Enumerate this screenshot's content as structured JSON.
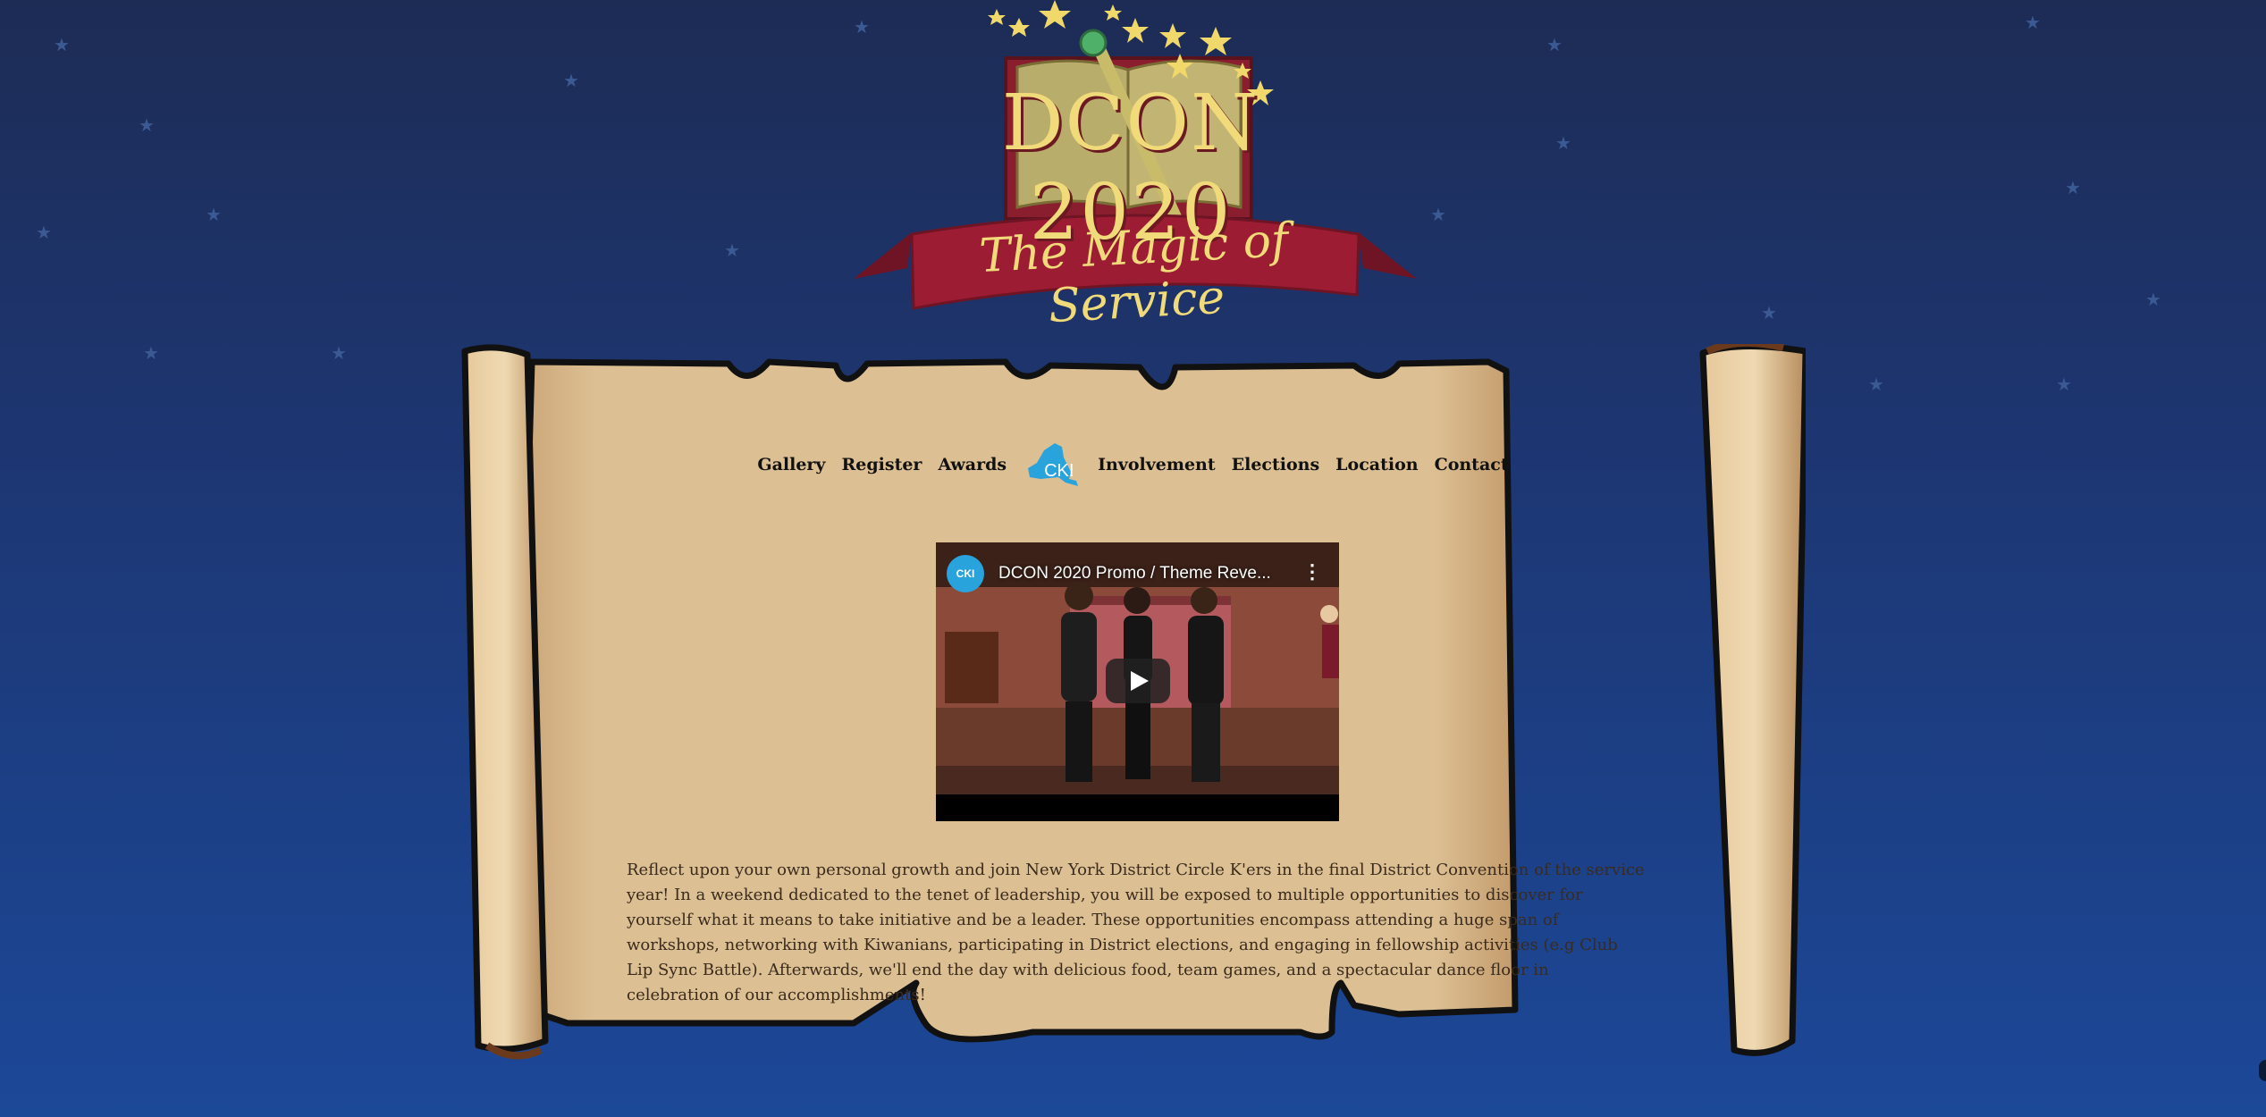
{
  "logo": {
    "title": "DCON 2020",
    "tagline": "The Magic of Service"
  },
  "nav": {
    "items": [
      "Gallery",
      "Register",
      "Awards",
      "Involvement",
      "Elections",
      "Location",
      "Contact"
    ],
    "logo_text": "CKI"
  },
  "video": {
    "title": "DCON 2020 Promo / Theme Reve...",
    "channel_avatar_text": "CKI",
    "menu_icon": "⋮"
  },
  "description": "Reflect upon your own personal growth and join New York District Circle K'ers in the final District Convention of the service year! In a weekend dedicated to the tenet of leadership, you will be exposed to multiple opportunities to discover for yourself what it means to take initiative and be a leader. These opportunities encompass attending a huge span of workshops, networking with Kiwanians, participating in District elections, and engaging in fellowship activities (e.g Club Lip Sync Battle). Afterwards, we'll end the day with delicious food, team games, and a spectacular dance floor in celebration of our accomplishments!",
  "colors": {
    "background_top": "#1d2c55",
    "background_bottom": "#1c4898",
    "parchment": "#dcbf93",
    "logo_gold": "#f0da7a",
    "banner_red": "#9c1c34",
    "cki_blue": "#29a3dc"
  }
}
